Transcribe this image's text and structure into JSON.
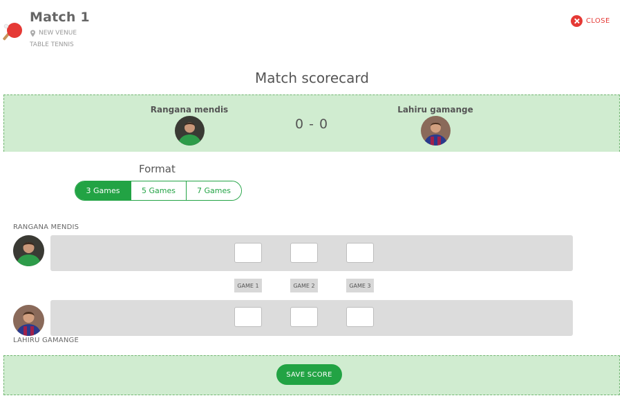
{
  "header": {
    "match_title": "Match 1",
    "venue": "NEW VENUE",
    "sport": "TABLE TENNIS",
    "close_label": "CLOSE",
    "sport_icon": "table-tennis-paddle-icon"
  },
  "scorecard": {
    "title": "Match scorecard",
    "player1_name": "Rangana mendis",
    "player2_name": "Lahiru gamange",
    "score": "0 - 0"
  },
  "format": {
    "label": "Format",
    "options": [
      "3 Games",
      "5 Games",
      "7 Games"
    ],
    "selected": "3 Games"
  },
  "rows": {
    "player1_label": "RANGANA MENDIS",
    "player2_label": "LAHIRU GAMANGE",
    "games": [
      "GAME 1",
      "GAME 2",
      "GAME 3"
    ],
    "player1_scores": [
      "",
      "",
      ""
    ],
    "player2_scores": [
      "",
      "",
      ""
    ]
  },
  "actions": {
    "save_label": "SAVE SCORE"
  },
  "colors": {
    "accent_green": "#22a344",
    "banner_green": "#d0ecd0",
    "close_red": "#e53935"
  }
}
